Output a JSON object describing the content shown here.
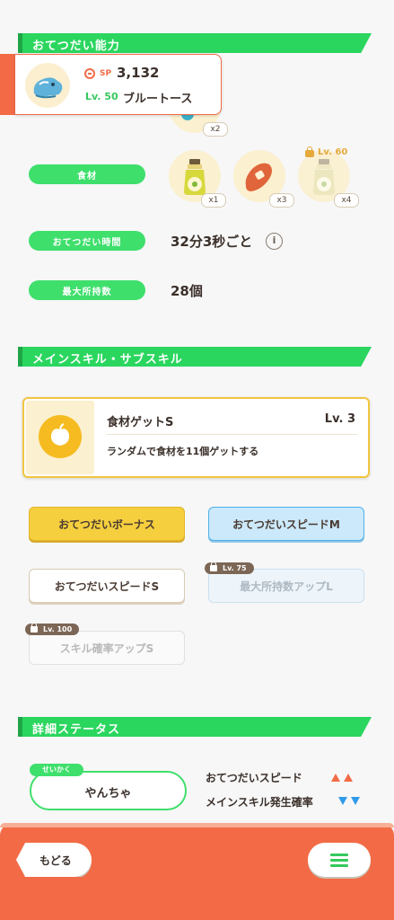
{
  "sections": {
    "helping_ability": "おてつだい能力",
    "main_sub_skill": "メインスキル・サブスキル",
    "detail_status": "詳細ステータス"
  },
  "pokemon_card": {
    "sp_label": "SP",
    "sp_value": "3,132",
    "level": "Lv. 50",
    "name": "ブルートース"
  },
  "top_item_qty": "x2",
  "ingredients": {
    "label": "食材",
    "items": [
      {
        "name": "oil-bottle",
        "qty": "x1"
      },
      {
        "name": "sausage",
        "qty": "x3"
      },
      {
        "name": "oil-bottle-locked",
        "qty": "x4",
        "unlock_level": "Lv. 60"
      }
    ]
  },
  "help_time": {
    "label": "おてつだい時間",
    "value": "32分3秒ごと"
  },
  "max_carry": {
    "label": "最大所持数",
    "value": "28個"
  },
  "main_skill": {
    "name": "食材ゲットS",
    "level": "Lv. 3",
    "description": "ランダムで食材を11個ゲットする"
  },
  "sub_skills": [
    {
      "label": "おてつだいボーナス",
      "style": "gold"
    },
    {
      "label": "おてつだいスピードM",
      "style": "blue"
    },
    {
      "label": "おてつだいスピードS",
      "style": "white"
    },
    {
      "label": "最大所持数アップL",
      "style": "locked",
      "unlock_level": "Lv. 75"
    },
    {
      "label": "スキル確率アップS",
      "style": "locked",
      "unlock_level": "Lv. 100"
    }
  ],
  "nature": {
    "tag": "せいかく",
    "value": "やんちゃ",
    "up_stat": "おてつだいスピード",
    "down_stat": "メインスキル発生確率"
  },
  "footer": {
    "back_label": "もどる"
  },
  "colors": {
    "header_green": "#2bd65f",
    "pill_green": "#3fdf6c",
    "footer_orange": "#f26b46",
    "skill_gold": "#f5cf3e",
    "skill_blue": "#cbe9fb",
    "up_red": "#f26b46",
    "down_blue": "#2f9bea"
  }
}
